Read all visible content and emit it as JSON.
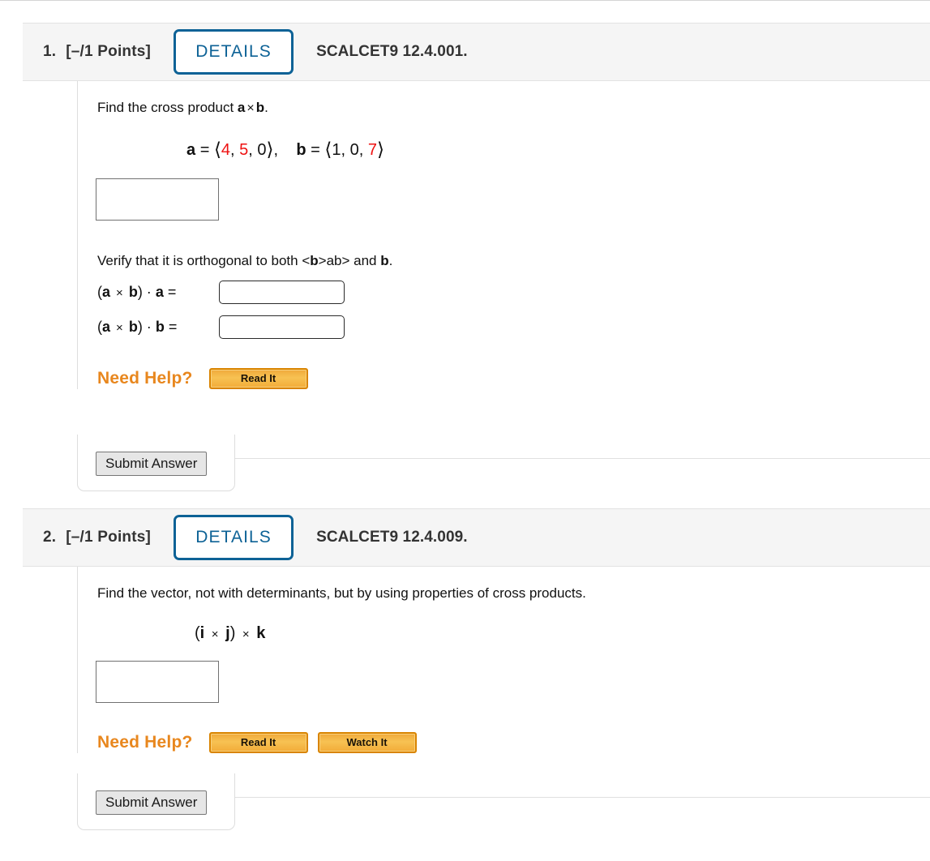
{
  "page": {
    "bg_color": "#ffffff"
  },
  "questions": [
    {
      "number": "1.",
      "points": "[–/1 Points]",
      "details_label": "DETAILS",
      "code": "SCALCET9 12.4.001.",
      "prompt_pre": "Find the cross product ",
      "prompt_a": "a",
      "prompt_times": "×",
      "prompt_b": "b",
      "prompt_post": ".",
      "vector_a": {
        "name": "a",
        "eq": "=",
        "open": "⟨",
        "components": [
          {
            "value": "4",
            "color": "#ee1111"
          },
          {
            "value": "5",
            "color": "#ee1111"
          },
          {
            "value": "0",
            "color": "#111111"
          }
        ],
        "close": "⟩",
        "comma": ","
      },
      "vector_b": {
        "name": "b",
        "eq": "=",
        "open": "⟨",
        "components": [
          {
            "value": "1",
            "color": "#111111"
          },
          {
            "value": "0",
            "color": "#111111"
          },
          {
            "value": "7",
            "color": "#ee1111"
          }
        ],
        "close": "⟩"
      },
      "verify_text": "Verify that it is orthogonal to both a and b.",
      "dot_rows": [
        {
          "label": "(a × b) · a  ="
        },
        {
          "label": "(a × b) · b  ="
        }
      ],
      "need_help_label": "Need Help?",
      "help_buttons": [
        "Read It"
      ],
      "submit_label": "Submit Answer"
    },
    {
      "number": "2.",
      "points": "[–/1 Points]",
      "details_label": "DETAILS",
      "code": "SCALCET9 12.4.009.",
      "prompt": "Find the vector, not with determinants, but by using properties of cross products.",
      "expression": "(i × j) × k",
      "need_help_label": "Need Help?",
      "help_buttons": [
        "Read It",
        "Watch It"
      ],
      "submit_label": "Submit Answer"
    }
  ],
  "colors": {
    "details_blue": "#0d6296",
    "need_help_orange": "#e8871e",
    "help_btn_orange": "#f2ab38",
    "red_value": "#ee1111",
    "header_bg": "#f5f5f5"
  }
}
